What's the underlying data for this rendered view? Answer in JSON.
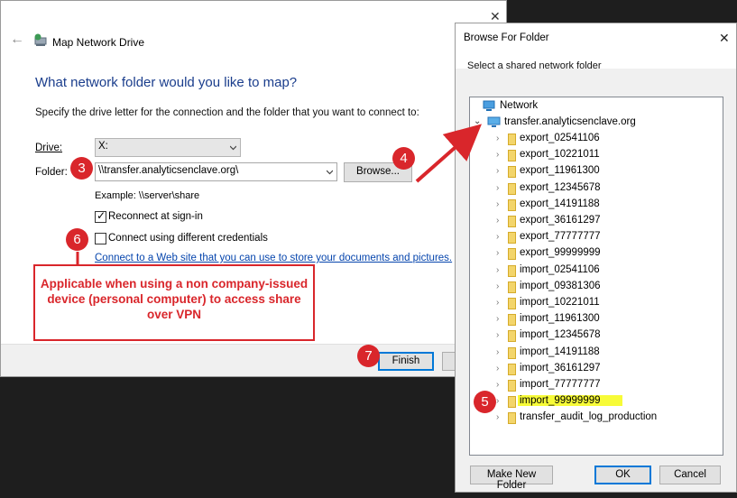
{
  "map_network_drive": {
    "title": "Map Network Drive",
    "heading": "What network folder would you like to map?",
    "description": "Specify the drive letter for the connection and the folder that you want to connect to:",
    "drive_label": "Drive:",
    "drive_value": "X:",
    "folder_label": "Folder:",
    "folder_value": "\\\\transfer.analyticsenclave.org\\",
    "browse_label": "Browse...",
    "example": "Example: \\\\server\\share",
    "reconnect_label": "Reconnect at sign-in",
    "reconnect_checked": true,
    "credentials_label": "Connect using different credentials",
    "credentials_checked": false,
    "website_link": "Connect to a Web site that you can use to store your documents and pictures.",
    "finish_label": "Finish"
  },
  "annotations": {
    "note": "Applicable when using a non company-issued device (personal computer) to access share over VPN",
    "badge_3": "3",
    "badge_4": "4",
    "badge_5": "5",
    "badge_6": "6",
    "badge_7": "7",
    "accent_color": "#d9262b",
    "highlight_color": "#f7fb38"
  },
  "browse_for_folder": {
    "title": "Browse For Folder",
    "description": "Select a shared network folder",
    "root": "Network",
    "server": "transfer.analyticsenclave.org",
    "folders": [
      "export_02541106",
      "export_10221011",
      "export_11961300",
      "export_12345678",
      "export_14191188",
      "export_36161297",
      "export_77777777",
      "export_99999999",
      "import_02541106",
      "import_09381306",
      "import_10221011",
      "import_11961300",
      "import_12345678",
      "import_14191188",
      "import_36161297",
      "import_77777777",
      "import_99999999",
      "transfer_audit_log_production"
    ],
    "selected_folder": "import_99999999",
    "make_new_folder_label": "Make New Folder",
    "ok_label": "OK",
    "cancel_label": "Cancel"
  }
}
